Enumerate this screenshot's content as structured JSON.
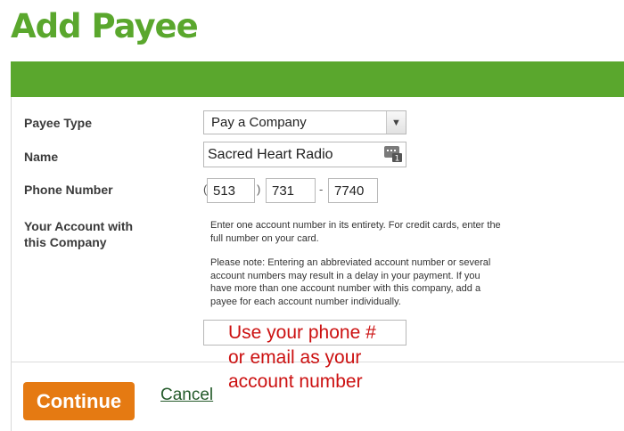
{
  "page": {
    "title": "Add Payee"
  },
  "form": {
    "payee_type": {
      "label": "Payee Type",
      "selected": "Pay a Company"
    },
    "name": {
      "label": "Name",
      "value": "Sacred Heart Radio"
    },
    "phone": {
      "label": "Phone Number",
      "open_paren": "(",
      "close_paren": ")",
      "dash": "-",
      "area_code": "513",
      "prefix": "731",
      "line": "7740"
    },
    "account": {
      "label_line1": "Your Account with",
      "label_line2": "this Company",
      "help_1a": "Enter one account number in its entirety. For credit cards, enter the",
      "help_1b": "full number on your card.",
      "help_2a": "Please note: Entering an abbreviated account number or several",
      "help_2b": "account numbers may result in a delay in your payment. If you",
      "help_2c": "have more than one account number with this company, add a",
      "help_2d": "payee for each account number individually.",
      "value": ""
    }
  },
  "annotation": {
    "line1": "Use your phone #",
    "line2": "or email as your",
    "line3": "account number",
    "color": "#cc1111"
  },
  "actions": {
    "continue_label": "Continue",
    "cancel_label": "Cancel"
  },
  "colors": {
    "brand_green": "#5aa72d",
    "continue_orange": "#e57a12"
  }
}
